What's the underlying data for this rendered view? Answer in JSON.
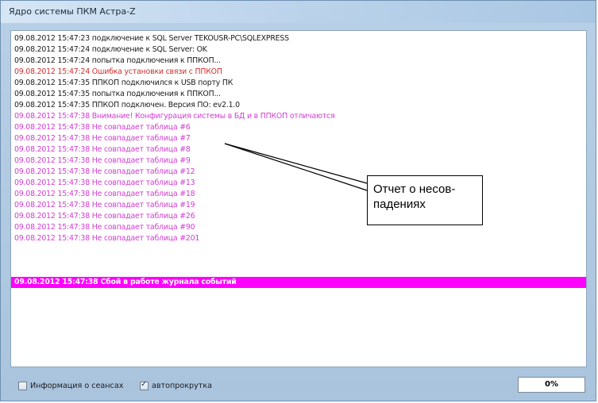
{
  "window": {
    "title": "Ядро системы ПКМ Астра-Z"
  },
  "log": {
    "lines": [
      "09.08.2012 15:47:23 подключение к SQL Server TEKOUSR-PC\\SQLEXPRESS",
      "09.08.2012 15:47:24 подключение к SQL Server: OK",
      "09.08.2012 15:47:24 попытка подключения к ППКОП...",
      "09.08.2012 15:47:24 Ошибка установки связи с ППКОП",
      "09.08.2012 15:47:35 ППКОП подключился к USB порту ПК",
      "09.08.2012 15:47:35 попытка подключения к ППКОП...",
      "09.08.2012 15:47:35 ППКОП подключен. Версия ПО: ev2.1.0",
      "09.08.2012 15:47:38 Внимание! Конфигурация системы в БД и в ППКОП отличаются",
      "09.08.2012 15:47:38 Не совпадает таблица #6",
      "09.08.2012 15:47:38 Не совпадает таблица #7",
      "09.08.2012 15:47:38 Не совпадает таблица #8",
      "09.08.2012 15:47:38 Не совпадает таблица #9",
      "09.08.2012 15:47:38 Не совпадает таблица #12",
      "09.08.2012 15:47:38 Не совпадает таблица #13",
      "09.08.2012 15:47:38 Не совпадает таблица #18",
      "09.08.2012 15:47:38 Не совпадает таблица #19",
      "09.08.2012 15:47:38 Не совпадает таблица #26",
      "09.08.2012 15:47:38 Не совпадает таблица #90",
      "09.08.2012 15:47:38 Не совпадает таблица #201",
      "09.08.2012 15:47:38 Сбой в работе журнала событий"
    ]
  },
  "annotation": {
    "text": "Отчет о несов-\nпадениях"
  },
  "footer": {
    "session_info_label": "Информация о сеансах",
    "session_info_checked": false,
    "autoscroll_label": "автопрокрутка",
    "autoscroll_checked": true,
    "progress_text": "0%"
  },
  "colors": {
    "normal": "#1a1a1a",
    "error": "#d52b2b",
    "warning": "#d23bd2",
    "highlight_bg": "#ff00ff"
  }
}
